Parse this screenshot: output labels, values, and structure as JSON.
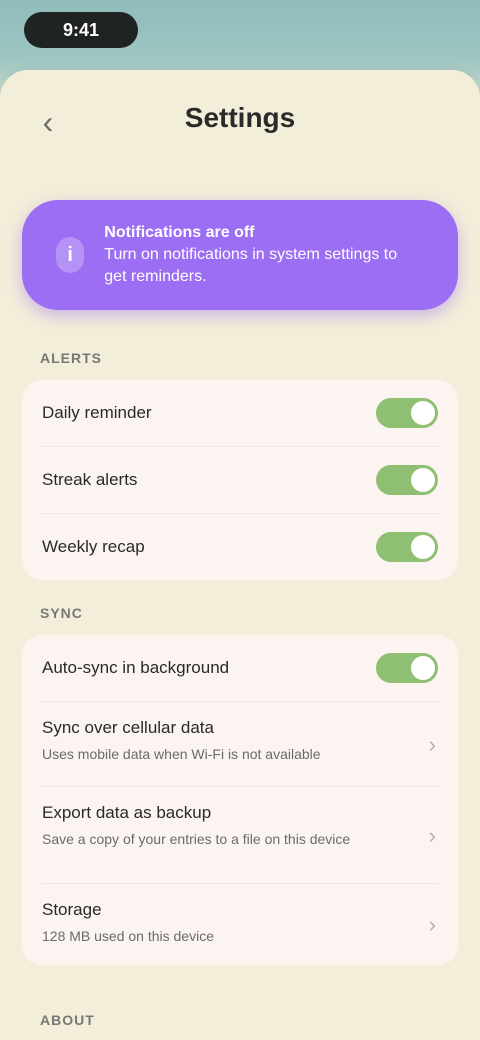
{
  "status": {
    "time": "9:41"
  },
  "header": {
    "back_label": "‹",
    "title": "Settings"
  },
  "banner": {
    "title": "Notifications are off",
    "text": "Turn on notifications in system settings to get reminders."
  },
  "sections": [
    {
      "label": "ALERTS",
      "rows": [
        {
          "label": "Daily reminder",
          "toggle": true
        },
        {
          "label": "Streak alerts",
          "toggle": true
        },
        {
          "label": "Weekly recap",
          "toggle": true
        }
      ]
    },
    {
      "label": "SYNC",
      "rows": [
        {
          "label": "Auto-sync in background",
          "toggle": true
        },
        {
          "label": "Sync over cellular data",
          "sub": "Uses mobile data when Wi-Fi is not available"
        },
        {
          "label": "Export data as backup",
          "sub": "Save a copy of your entries to a file on this device"
        },
        {
          "label": "Storage",
          "sub": "128 MB used on this device"
        }
      ]
    },
    {
      "label": "ABOUT"
    }
  ],
  "colors": {
    "accent": "#9b6ef3",
    "toggle_on": "#8fbf73",
    "background": "#f3eed9",
    "card": "#fbf4f1"
  }
}
